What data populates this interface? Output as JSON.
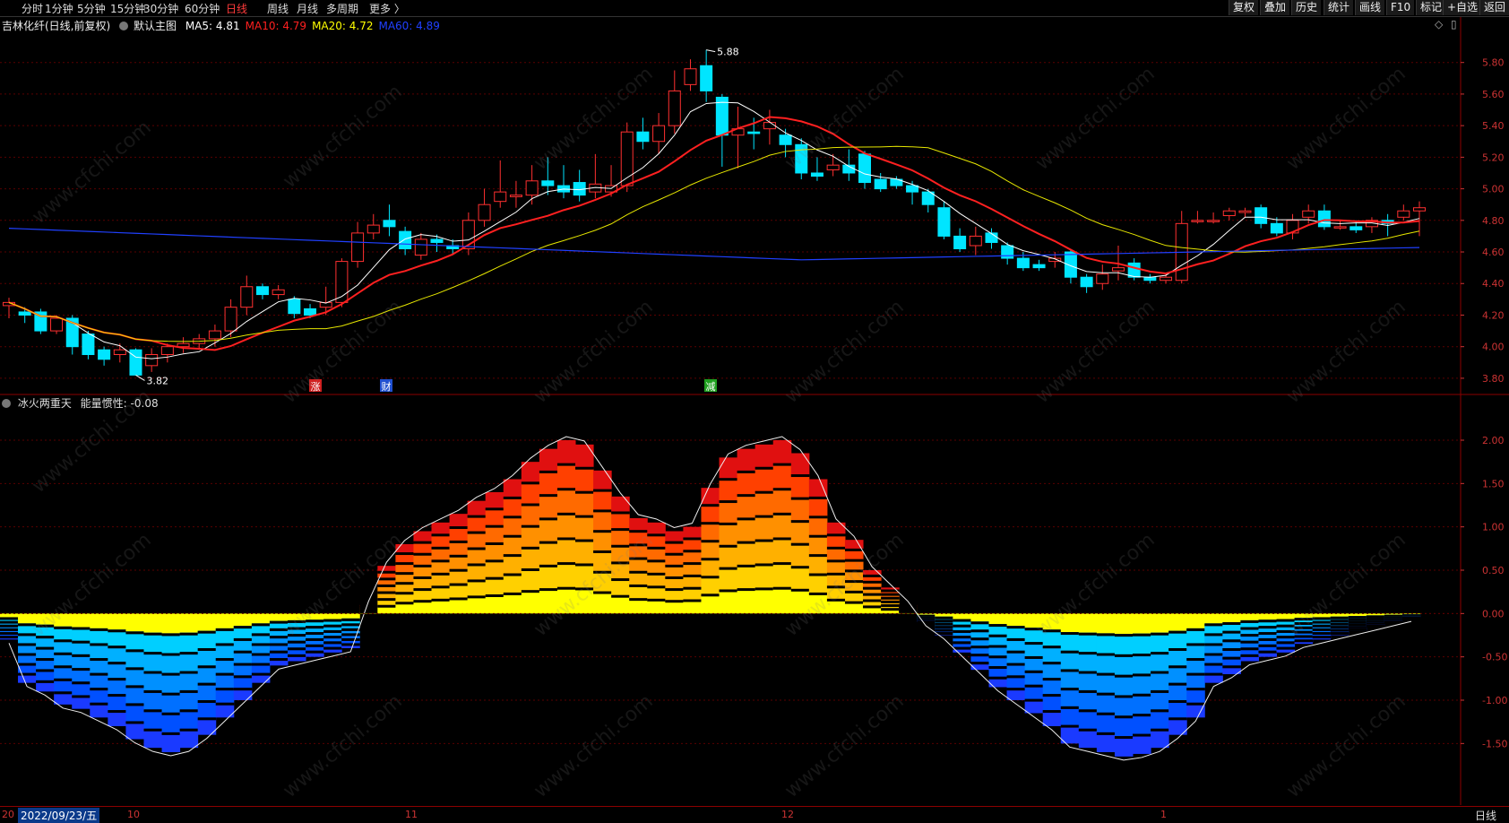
{
  "toolbar": {
    "tabs": [
      "分时",
      "1分钟",
      "5分钟",
      "15分钟",
      "30分钟",
      "60分钟",
      "日线",
      "周线",
      "月线",
      "多周期",
      "更多 〉"
    ],
    "active_tab": "日线",
    "right_buttons": [
      "复权",
      "叠加",
      "历史",
      "统计",
      "画线",
      "F10",
      "标记",
      "+自选",
      "返回"
    ]
  },
  "main_chart": {
    "stock": "吉林化纤(日线,前复权)",
    "theme": "默认主图",
    "ma": [
      {
        "label": "MA5:",
        "value": "4.81",
        "color": "#ffffff"
      },
      {
        "label": "MA10:",
        "value": "4.79",
        "color": "#ff2020"
      },
      {
        "label": "MA20:",
        "value": "4.72",
        "color": "#ffff00"
      },
      {
        "label": "MA60:",
        "value": "4.89",
        "color": "#2040ff"
      }
    ],
    "high_label": "5.88",
    "low_label": "3.82",
    "markers": [
      "涨",
      "财",
      "减"
    ],
    "y_ticks": [
      "5.80",
      "5.60",
      "5.40",
      "5.20",
      "5.00",
      "4.80",
      "4.60",
      "4.40",
      "4.20",
      "4.00",
      "3.80"
    ]
  },
  "indicator": {
    "name": "冰火两重天",
    "param_label": "能量惯性:",
    "param_value": "-0.08",
    "y_ticks": [
      "2.00",
      "1.50",
      "1.00",
      "0.50",
      "0.00",
      "-0.50",
      "-1.00",
      "-1.50"
    ]
  },
  "bottom": {
    "date": "2022/09/23/五",
    "period": "日线",
    "month_ticks": [
      "20",
      "10",
      "11",
      "12",
      "1"
    ]
  },
  "watermark": "www.cfchi.com",
  "chart_data": [
    {
      "type": "candlestick",
      "title": "吉林化纤(日线,前复权)",
      "ylim": [
        3.72,
        5.98
      ],
      "candles": [
        [
          4.26,
          4.28,
          4.18,
          4.31
        ],
        [
          4.22,
          4.2,
          4.15,
          4.25
        ],
        [
          4.22,
          4.1,
          4.08,
          4.24
        ],
        [
          4.1,
          4.18,
          4.08,
          4.2
        ],
        [
          4.18,
          4.0,
          3.95,
          4.2
        ],
        [
          4.08,
          3.95,
          3.92,
          4.1
        ],
        [
          3.98,
          3.92,
          3.88,
          4.0
        ],
        [
          3.95,
          3.98,
          3.9,
          4.02
        ],
        [
          3.98,
          3.82,
          3.82,
          3.99
        ],
        [
          3.88,
          3.95,
          3.84,
          3.99
        ],
        [
          3.95,
          4.0,
          3.9,
          4.02
        ],
        [
          4.0,
          4.02,
          3.96,
          4.06
        ],
        [
          4.02,
          4.05,
          3.98,
          4.08
        ],
        [
          4.05,
          4.1,
          4.0,
          4.14
        ],
        [
          4.1,
          4.25,
          4.06,
          4.3
        ],
        [
          4.25,
          4.38,
          4.2,
          4.45
        ],
        [
          4.38,
          4.33,
          4.3,
          4.4
        ],
        [
          4.33,
          4.36,
          4.3,
          4.39
        ],
        [
          4.3,
          4.21,
          4.18,
          4.32
        ],
        [
          4.24,
          4.2,
          4.18,
          4.27
        ],
        [
          4.25,
          4.28,
          4.2,
          4.38
        ],
        [
          4.28,
          4.54,
          4.25,
          4.56
        ],
        [
          4.54,
          4.72,
          4.5,
          4.79
        ],
        [
          4.72,
          4.77,
          4.68,
          4.84
        ],
        [
          4.8,
          4.76,
          4.7,
          4.9
        ],
        [
          4.73,
          4.62,
          4.58,
          4.76
        ],
        [
          4.58,
          4.68,
          4.55,
          4.72
        ],
        [
          4.68,
          4.66,
          4.6,
          4.71
        ],
        [
          4.64,
          4.62,
          4.58,
          4.68
        ],
        [
          4.62,
          4.8,
          4.58,
          4.85
        ],
        [
          4.8,
          4.9,
          4.76,
          5.0
        ],
        [
          4.92,
          4.98,
          4.88,
          5.18
        ],
        [
          4.95,
          4.96,
          4.88,
          5.05
        ],
        [
          4.96,
          5.05,
          4.9,
          5.15
        ],
        [
          5.05,
          5.02,
          4.96,
          5.2
        ],
        [
          5.02,
          4.98,
          4.94,
          5.15
        ],
        [
          5.04,
          4.96,
          4.92,
          5.12
        ],
        [
          4.98,
          5.03,
          4.94,
          5.22
        ],
        [
          4.98,
          5.02,
          4.95,
          5.15
        ],
        [
          5.02,
          5.36,
          4.98,
          5.42
        ],
        [
          5.36,
          5.3,
          5.25,
          5.45
        ],
        [
          5.3,
          5.4,
          5.22,
          5.48
        ],
        [
          5.4,
          5.62,
          5.35,
          5.75
        ],
        [
          5.66,
          5.76,
          5.62,
          5.82
        ],
        [
          5.78,
          5.62,
          5.55,
          5.88
        ],
        [
          5.58,
          5.34,
          5.14,
          5.6
        ],
        [
          5.34,
          5.38,
          5.13,
          5.52
        ],
        [
          5.36,
          5.35,
          5.25,
          5.45
        ],
        [
          5.38,
          5.42,
          5.28,
          5.5
        ],
        [
          5.34,
          5.28,
          5.2,
          5.38
        ],
        [
          5.28,
          5.1,
          5.06,
          5.32
        ],
        [
          5.1,
          5.08,
          5.05,
          5.2
        ],
        [
          5.12,
          5.15,
          5.08,
          5.22
        ],
        [
          5.15,
          5.1,
          5.05,
          5.25
        ],
        [
          5.22,
          5.04,
          5.0,
          5.24
        ],
        [
          5.06,
          5.0,
          4.98,
          5.1
        ],
        [
          5.06,
          5.02,
          5.0,
          5.08
        ],
        [
          5.02,
          4.98,
          4.9,
          5.05
        ],
        [
          4.98,
          4.9,
          4.85,
          5.0
        ],
        [
          4.88,
          4.7,
          4.68,
          4.92
        ],
        [
          4.7,
          4.62,
          4.6,
          4.75
        ],
        [
          4.64,
          4.7,
          4.58,
          4.76
        ],
        [
          4.72,
          4.66,
          4.62,
          4.75
        ],
        [
          4.64,
          4.56,
          4.52,
          4.66
        ],
        [
          4.56,
          4.5,
          4.48,
          4.6
        ],
        [
          4.52,
          4.5,
          4.48,
          4.55
        ],
        [
          4.54,
          4.56,
          4.5,
          4.6
        ],
        [
          4.6,
          4.44,
          4.4,
          4.62
        ],
        [
          4.44,
          4.38,
          4.34,
          4.46
        ],
        [
          4.4,
          4.46,
          4.36,
          4.52
        ],
        [
          4.48,
          4.5,
          4.42,
          4.64
        ],
        [
          4.53,
          4.44,
          4.42,
          4.56
        ],
        [
          4.44,
          4.42,
          4.4,
          4.46
        ],
        [
          4.42,
          4.44,
          4.4,
          4.46
        ],
        [
          4.42,
          4.78,
          4.4,
          4.86
        ],
        [
          4.8,
          4.8,
          4.78,
          4.86
        ],
        [
          4.8,
          4.8,
          4.78,
          4.85
        ],
        [
          4.83,
          4.86,
          4.8,
          4.88
        ],
        [
          4.85,
          4.86,
          4.82,
          4.88
        ],
        [
          4.88,
          4.78,
          4.75,
          4.9
        ],
        [
          4.78,
          4.72,
          4.7,
          4.82
        ],
        [
          4.72,
          4.8,
          4.68,
          4.84
        ],
        [
          4.82,
          4.86,
          4.78,
          4.9
        ],
        [
          4.86,
          4.76,
          4.74,
          4.9
        ],
        [
          4.76,
          4.76,
          4.74,
          4.8
        ],
        [
          4.76,
          4.74,
          4.72,
          4.8
        ],
        [
          4.76,
          4.8,
          4.72,
          4.82
        ],
        [
          4.8,
          4.78,
          4.7,
          4.84
        ],
        [
          4.82,
          4.86,
          4.8,
          4.9
        ],
        [
          4.86,
          4.88,
          4.7,
          4.92
        ]
      ]
    },
    {
      "type": "area",
      "title": "冰火两重天",
      "ylim": [
        -2.2,
        2.3
      ],
      "values": [
        -0.3,
        -0.8,
        -0.9,
        -1.05,
        -1.1,
        -1.2,
        -1.3,
        -1.45,
        -1.55,
        -1.6,
        -1.55,
        -1.4,
        -1.2,
        -1.0,
        -0.8,
        -0.6,
        -0.55,
        -0.5,
        -0.45,
        -0.4,
        0.1,
        0.55,
        0.8,
        0.95,
        1.05,
        1.15,
        1.3,
        1.4,
        1.55,
        1.75,
        1.9,
        2.0,
        1.95,
        1.65,
        1.35,
        1.1,
        1.05,
        0.95,
        1.0,
        1.45,
        1.8,
        1.9,
        1.95,
        2.0,
        1.85,
        1.55,
        1.05,
        0.85,
        0.5,
        0.3,
        0.1,
        -0.1,
        -0.25,
        -0.45,
        -0.65,
        -0.85,
        -1.0,
        -1.15,
        -1.3,
        -1.5,
        -1.55,
        -1.6,
        -1.65,
        -1.62,
        -1.55,
        -1.4,
        -1.2,
        -0.8,
        -0.7,
        -0.55,
        -0.5,
        -0.45,
        -0.35,
        -0.3,
        -0.25,
        -0.2,
        -0.15,
        -0.1,
        -0.05
      ]
    }
  ]
}
